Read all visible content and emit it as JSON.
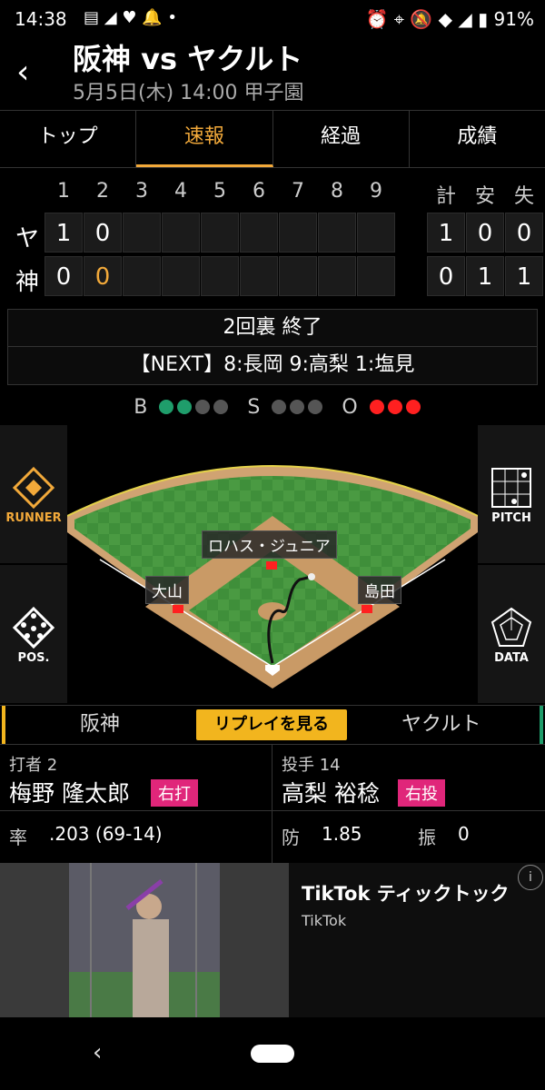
{
  "status_bar": {
    "time": "14:38",
    "battery": "91%",
    "icons": [
      "news-icon",
      "signal-icon",
      "heart-icon",
      "bell-icon",
      "dot-icon",
      "alarm-icon",
      "location-icon",
      "mute-icon",
      "wifi-icon",
      "cell-icon",
      "battery-icon"
    ]
  },
  "header": {
    "title": "阪神 vs ヤクルト",
    "subtitle": "5月5日(木) 14:00 甲子園"
  },
  "tabs": [
    {
      "label": "トップ"
    },
    {
      "label": "速報"
    },
    {
      "label": "経過"
    },
    {
      "label": "成績"
    }
  ],
  "scoreboard": {
    "innings": [
      "1",
      "2",
      "3",
      "4",
      "5",
      "6",
      "7",
      "8",
      "9"
    ],
    "totals_headers": [
      "計",
      "安",
      "失"
    ],
    "teams": [
      {
        "abbr": "ヤ",
        "scores": [
          "1",
          "0",
          "",
          "",
          "",
          "",
          "",
          "",
          ""
        ],
        "totals": [
          "1",
          "0",
          "0"
        ]
      },
      {
        "abbr": "神",
        "scores": [
          "0",
          "0",
          "",
          "",
          "",
          "",
          "",
          "",
          ""
        ],
        "totals": [
          "0",
          "1",
          "1"
        ]
      }
    ]
  },
  "inning_status": {
    "state": "2回裏 終了",
    "next": "【NEXT】8:長岡 9:高梨 1:塩見"
  },
  "count": {
    "ball_label": "B",
    "strike_label": "S",
    "out_label": "O",
    "balls": 2,
    "strikes": 0,
    "outs": 3
  },
  "field": {
    "runner_label": "RUNNER",
    "pitch_label": "PITCH",
    "pos_label": "POS.",
    "data_label": "DATA",
    "players": {
      "center": "ロハス・ジュニア",
      "left": "大山",
      "right": "島田"
    }
  },
  "team_switch": {
    "home": "阪神",
    "replay": "リプレイを見る",
    "away": "ヤクルト"
  },
  "batter": {
    "role": "打者 2",
    "name": "梅野 隆太郎",
    "hand": "右打",
    "stat_label": "率",
    "stat_value": ".203 (69-14)"
  },
  "pitcher": {
    "role": "投手 14",
    "name": "高梨 裕稔",
    "hand": "右投",
    "era_label": "防",
    "era_value": "1.85",
    "k_label": "振",
    "k_value": "0"
  },
  "ad": {
    "title": "TikTok ティックトック",
    "subtitle": "TikTok",
    "info_icon": "info-icon"
  },
  "colors": {
    "accent": "#f2a93a",
    "ball": "#1f9d6b",
    "out": "#ff2020",
    "inactive": "#555555",
    "hand_badge": "#e0267a",
    "replay": "#f2b51e"
  }
}
